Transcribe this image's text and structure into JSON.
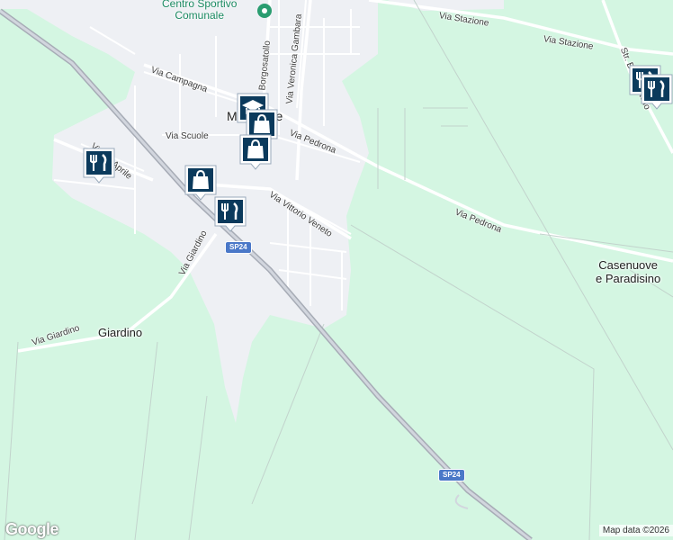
{
  "map": {
    "streets": [
      {
        "key": "via-stazione-1",
        "text": "Via Stazione"
      },
      {
        "key": "via-stazione-2",
        "text": "Via Stazione"
      },
      {
        "key": "via-campagna",
        "text": "Via Campagna"
      },
      {
        "key": "via-borgosatollo",
        "text": "Via Borgosatollo"
      },
      {
        "key": "via-veronica-gambara",
        "text": "Via Veronica Gambara"
      },
      {
        "key": "via-scuole",
        "text": "Via Scuole"
      },
      {
        "key": "via-pedrona-1",
        "text": "Via Pedrona"
      },
      {
        "key": "via-pedrona-2",
        "text": "Via Pedrona"
      },
      {
        "key": "via-25-aprile",
        "text": "Via 25 Aprile"
      },
      {
        "key": "via-vittorio-veneto",
        "text": "Via Vittorio Veneto"
      },
      {
        "key": "via-giardino-1",
        "text": "Via Giardino"
      },
      {
        "key": "via-giardino-2",
        "text": "Via Giardino"
      },
      {
        "key": "str-borgosatollo",
        "text": "Str. Borgosatollo"
      }
    ],
    "places": {
      "town": "Montirone",
      "giardino": "Giardino",
      "casenuove_line1": "Casenuove",
      "casenuove_line2": "e Paradisino"
    },
    "poi": {
      "line1": "Centro Sportivo",
      "line2": "Comunale"
    },
    "road_shields": [
      "SP24",
      "SP24"
    ],
    "markers": [
      {
        "type": "restaurant",
        "icon": "fork-knife-icon"
      },
      {
        "type": "school",
        "icon": "graduation-cap-icon"
      },
      {
        "type": "shop",
        "icon": "shopping-bag-icon"
      },
      {
        "type": "shop",
        "icon": "shopping-bag-icon"
      },
      {
        "type": "shop",
        "icon": "shopping-bag-icon"
      },
      {
        "type": "restaurant",
        "icon": "fork-knife-icon"
      },
      {
        "type": "restaurant",
        "icon": "fork-knife-icon"
      },
      {
        "type": "restaurant",
        "icon": "fork-knife-icon"
      }
    ],
    "logo": "Google",
    "attribution": "Map data ©2026"
  },
  "colors": {
    "land": "#d4f6e2",
    "urban": "#eef0f4",
    "road": "#ffffff",
    "highway": "#b9bec8",
    "marker_fill": "#0b3a5c",
    "shield": "#4a78c8",
    "poi": "#1b8a62"
  }
}
